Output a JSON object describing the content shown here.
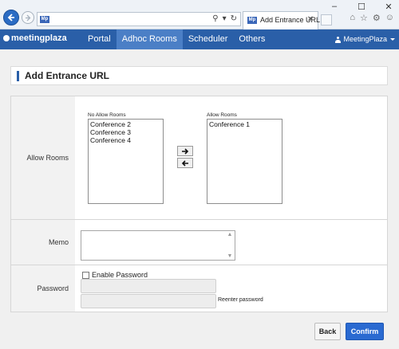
{
  "browser": {
    "favicon_text": "Mp",
    "tab_title": "Add Entrance URL",
    "icons": [
      "back-icon",
      "forward-icon",
      "search-icon",
      "refresh-icon",
      "close-icon",
      "home-icon",
      "star-icon",
      "gear-icon",
      "smiley-icon"
    ]
  },
  "navbar": {
    "logo": "meetingplaza",
    "items": [
      "Portal",
      "Adhoc Rooms",
      "Scheduler",
      "Others"
    ],
    "active_item": "Adhoc Rooms",
    "user": "MeetingPlaza",
    "accent": "#2a5fa8"
  },
  "page": {
    "title": "Add Entrance URL"
  },
  "form": {
    "allow_rooms": {
      "label": "Allow Rooms",
      "no_allow_caption": "No Allow Rooms",
      "no_allow_items": [
        "Conference 2",
        "Conference 3",
        "Conference 4"
      ],
      "allow_caption": "Allow Rooms",
      "allow_items": [
        "Conference 1"
      ]
    },
    "memo": {
      "label": "Memo",
      "value": ""
    },
    "password": {
      "label": "Password",
      "enable_label": "Enable Password",
      "enabled": false,
      "reenter_label": "Reenter password"
    }
  },
  "actions": {
    "back_label": "Back",
    "confirm_label": "Confirm",
    "confirm_color": "#2a6ad1"
  }
}
